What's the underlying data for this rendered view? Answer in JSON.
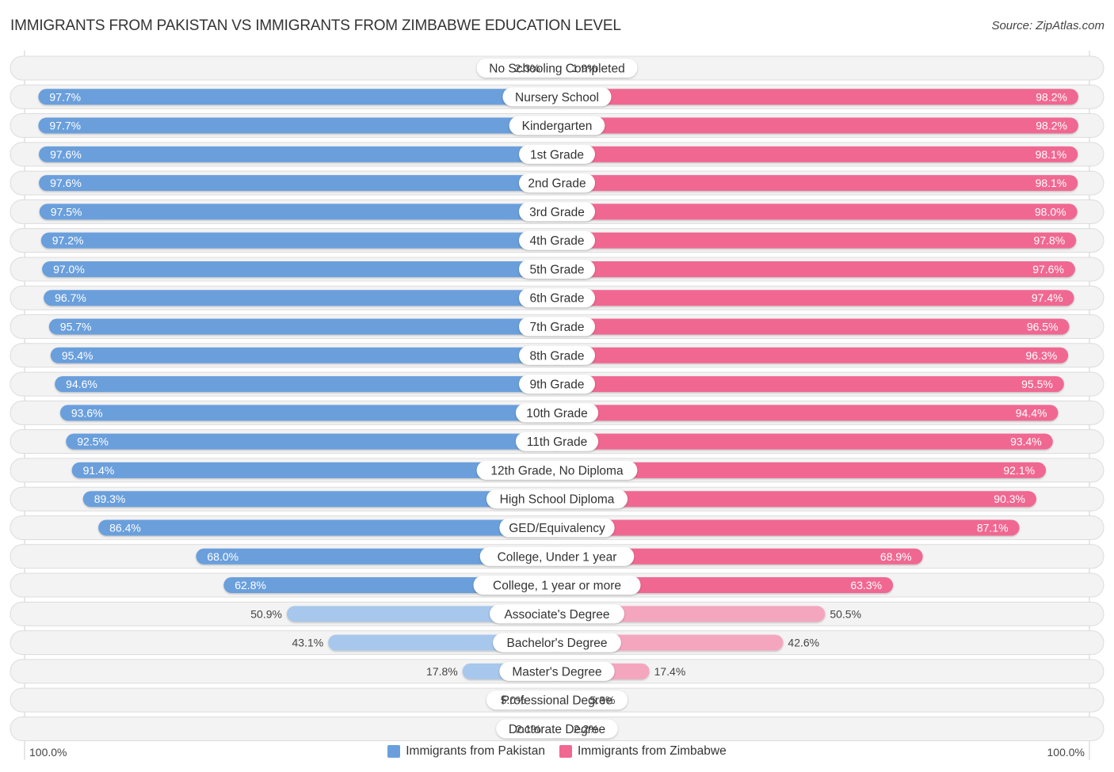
{
  "header": {
    "title": "IMMIGRANTS FROM PAKISTAN VS IMMIGRANTS FROM ZIMBABWE EDUCATION LEVEL",
    "source": "Source: ZipAtlas.com"
  },
  "axis": {
    "left_label": "100.0%",
    "right_label": "100.0%"
  },
  "legend": [
    {
      "label": "Immigrants from Pakistan",
      "color": "#6a9fdc"
    },
    {
      "label": "Immigrants from Zimbabwe",
      "color": "#f06792"
    }
  ],
  "colors": {
    "left_strong": "#6a9fdc",
    "left_light": "#a7c7ec",
    "right_strong": "#f06792",
    "right_light": "#f5a6bf",
    "track": "#f3f3f3"
  },
  "chart_data": {
    "type": "bar",
    "orientation": "horizontal-diverging",
    "title": "IMMIGRANTS FROM PAKISTAN VS IMMIGRANTS FROM ZIMBABWE EDUCATION LEVEL",
    "xlabel": "",
    "ylabel": "",
    "xlim": [
      0,
      100
    ],
    "unit": "%",
    "legend_position": "bottom-center",
    "categories": [
      "No Schooling Completed",
      "Nursery School",
      "Kindergarten",
      "1st Grade",
      "2nd Grade",
      "3rd Grade",
      "4th Grade",
      "5th Grade",
      "6th Grade",
      "7th Grade",
      "8th Grade",
      "9th Grade",
      "10th Grade",
      "11th Grade",
      "12th Grade, No Diploma",
      "High School Diploma",
      "GED/Equivalency",
      "College, Under 1 year",
      "College, 1 year or more",
      "Associate's Degree",
      "Bachelor's Degree",
      "Master's Degree",
      "Professional Degree",
      "Doctorate Degree"
    ],
    "series": [
      {
        "name": "Immigrants from Pakistan",
        "side": "left",
        "values": [
          2.3,
          97.7,
          97.7,
          97.6,
          97.6,
          97.5,
          97.2,
          97.0,
          96.7,
          95.7,
          95.4,
          94.6,
          93.6,
          92.5,
          91.4,
          89.3,
          86.4,
          68.0,
          62.8,
          50.9,
          43.1,
          17.8,
          5.0,
          2.1
        ],
        "labels": [
          "2.3%",
          "97.7%",
          "97.7%",
          "97.6%",
          "97.6%",
          "97.5%",
          "97.2%",
          "97.0%",
          "96.7%",
          "95.7%",
          "95.4%",
          "94.6%",
          "93.6%",
          "92.5%",
          "91.4%",
          "89.3%",
          "86.4%",
          "68.0%",
          "62.8%",
          "50.9%",
          "43.1%",
          "17.8%",
          "5.0%",
          "2.1%"
        ]
      },
      {
        "name": "Immigrants from Zimbabwe",
        "side": "right",
        "values": [
          1.9,
          98.2,
          98.2,
          98.1,
          98.1,
          98.0,
          97.8,
          97.6,
          97.4,
          96.5,
          96.3,
          95.5,
          94.4,
          93.4,
          92.1,
          90.3,
          87.1,
          68.9,
          63.3,
          50.5,
          42.6,
          17.4,
          5.3,
          2.2
        ],
        "labels": [
          "1.9%",
          "98.2%",
          "98.2%",
          "98.1%",
          "98.1%",
          "98.0%",
          "97.8%",
          "97.6%",
          "97.4%",
          "96.5%",
          "96.3%",
          "95.5%",
          "94.4%",
          "93.4%",
          "92.1%",
          "90.3%",
          "87.1%",
          "68.9%",
          "63.3%",
          "50.5%",
          "42.6%",
          "17.4%",
          "5.3%",
          "2.2%"
        ]
      }
    ]
  }
}
